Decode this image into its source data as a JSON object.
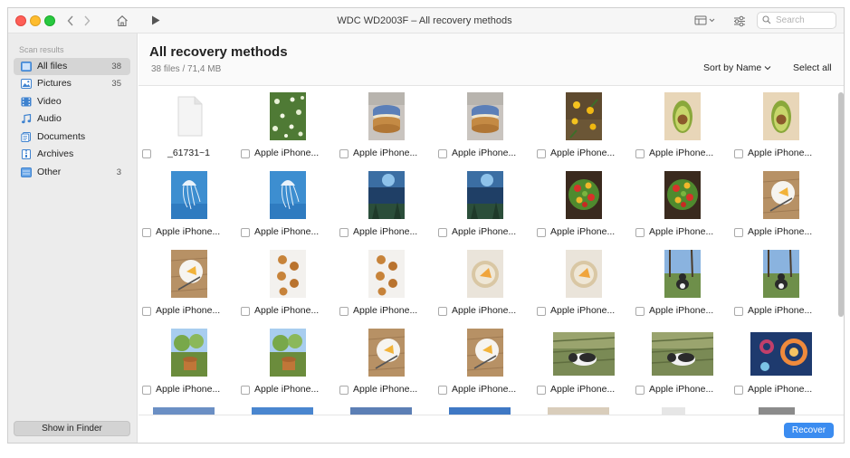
{
  "window": {
    "title": "WDC WD2003F – All recovery methods",
    "search_placeholder": "Search"
  },
  "colors": {
    "accent": "#3b8cf0",
    "sidebar_bg": "#ececec",
    "sidebar_active": "#d5d5d5",
    "traffic_red": "#fe5f57",
    "traffic_yellow": "#febc2e",
    "traffic_green": "#28c840"
  },
  "toolbar": {
    "icons": [
      "chevron-left-icon",
      "chevron-right-icon",
      "home-icon",
      "play-icon",
      "view-options-icon",
      "filter-icon",
      "search-icon"
    ]
  },
  "sidebar": {
    "header": "Scan results",
    "items": [
      {
        "label": "All files",
        "count": "38",
        "icon": "all-files-icon"
      },
      {
        "label": "Pictures",
        "count": "35",
        "icon": "pictures-icon"
      },
      {
        "label": "Video",
        "count": "",
        "icon": "video-icon"
      },
      {
        "label": "Audio",
        "count": "",
        "icon": "music-note-icon"
      },
      {
        "label": "Documents",
        "count": "",
        "icon": "documents-icon"
      },
      {
        "label": "Archives",
        "count": "",
        "icon": "archive-icon"
      },
      {
        "label": "Other",
        "count": "3",
        "icon": "other-icon"
      }
    ],
    "finder_button": "Show in Finder"
  },
  "main": {
    "title": "All recovery methods",
    "subtitle": "38 files / 71,4 MB",
    "sort_label": "Sort by Name",
    "select_all_label": "Select all",
    "recover_label": "Recover"
  },
  "files": [
    {
      "name": "_61731~1",
      "thumb": "document-icon"
    },
    {
      "name": "Apple iPhone...",
      "thumb": "flowers"
    },
    {
      "name": "Apple iPhone...",
      "thumb": "macaron"
    },
    {
      "name": "Apple iPhone...",
      "thumb": "macaron"
    },
    {
      "name": "Apple iPhone...",
      "thumb": "yellow-flowers"
    },
    {
      "name": "Apple iPhone...",
      "thumb": "avocado"
    },
    {
      "name": "Apple iPhone...",
      "thumb": "avocado"
    },
    {
      "name": "Apple iPhone...",
      "thumb": "jellyfish"
    },
    {
      "name": "Apple iPhone...",
      "thumb": "jellyfish"
    },
    {
      "name": "Apple iPhone...",
      "thumb": "underwater"
    },
    {
      "name": "Apple iPhone...",
      "thumb": "underwater"
    },
    {
      "name": "Apple iPhone...",
      "thumb": "salad"
    },
    {
      "name": "Apple iPhone...",
      "thumb": "salad"
    },
    {
      "name": "Apple iPhone...",
      "thumb": "pie-plate"
    },
    {
      "name": "Apple iPhone...",
      "thumb": "pie-plate"
    },
    {
      "name": "Apple iPhone...",
      "thumb": "pastries"
    },
    {
      "name": "Apple iPhone...",
      "thumb": "pastries"
    },
    {
      "name": "Apple iPhone...",
      "thumb": "tart"
    },
    {
      "name": "Apple iPhone...",
      "thumb": "tart"
    },
    {
      "name": "Apple iPhone...",
      "thumb": "cat-yard"
    },
    {
      "name": "Apple iPhone...",
      "thumb": "cat-yard"
    },
    {
      "name": "Apple iPhone...",
      "thumb": "garden"
    },
    {
      "name": "Apple iPhone...",
      "thumb": "garden"
    },
    {
      "name": "Apple iPhone...",
      "thumb": "pie-plate"
    },
    {
      "name": "Apple iPhone...",
      "thumb": "pie-plate"
    },
    {
      "name": "Apple iPhone...",
      "thumb": "cat-grass"
    },
    {
      "name": "Apple iPhone...",
      "thumb": "cat-grass"
    },
    {
      "name": "Apple iPhone...",
      "thumb": "fireworks"
    }
  ]
}
